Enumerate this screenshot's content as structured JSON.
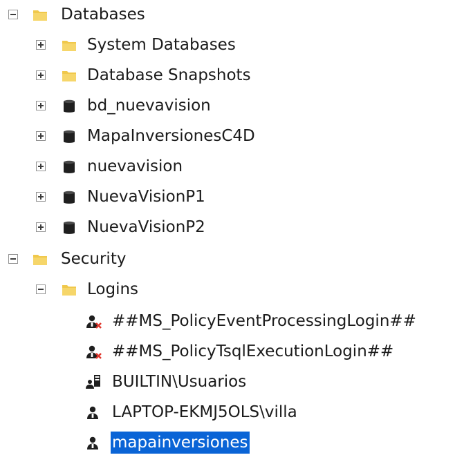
{
  "tree": {
    "databases": {
      "label": "Databases",
      "icon": "folder-icon",
      "expanded": true,
      "children": [
        {
          "label": "System Databases",
          "icon": "folder-icon",
          "expanded": false
        },
        {
          "label": "Database Snapshots",
          "icon": "folder-icon",
          "expanded": false
        },
        {
          "label": "bd_nuevavision",
          "icon": "database-icon",
          "expanded": false
        },
        {
          "label": "MapaInversionesC4D",
          "icon": "database-icon",
          "expanded": false
        },
        {
          "label": "nuevavision",
          "icon": "database-icon",
          "expanded": false
        },
        {
          "label": "NuevaVisionP1",
          "icon": "database-icon",
          "expanded": false
        },
        {
          "label": "NuevaVisionP2",
          "icon": "database-icon",
          "expanded": false
        }
      ]
    },
    "security": {
      "label": "Security",
      "icon": "folder-icon",
      "expanded": true,
      "logins": {
        "label": "Logins",
        "icon": "folder-icon",
        "expanded": true,
        "items": [
          {
            "label": "##MS_PolicyEventProcessingLogin##",
            "icon": "disabled-login-icon"
          },
          {
            "label": "##MS_PolicyTsqlExecutionLogin##",
            "icon": "disabled-login-icon"
          },
          {
            "label": "BUILTIN\\Usuarios",
            "icon": "group-login-icon"
          },
          {
            "label": "LAPTOP-EKMJ5OLS\\villa",
            "icon": "user-login-icon"
          },
          {
            "label": "mapainversiones",
            "icon": "user-login-icon",
            "selected": true
          }
        ]
      }
    }
  },
  "colors": {
    "folder": "#f0c84b",
    "database": "#1f1f1f",
    "selection": "#0a64d6",
    "disabled_x": "#e0352b"
  }
}
